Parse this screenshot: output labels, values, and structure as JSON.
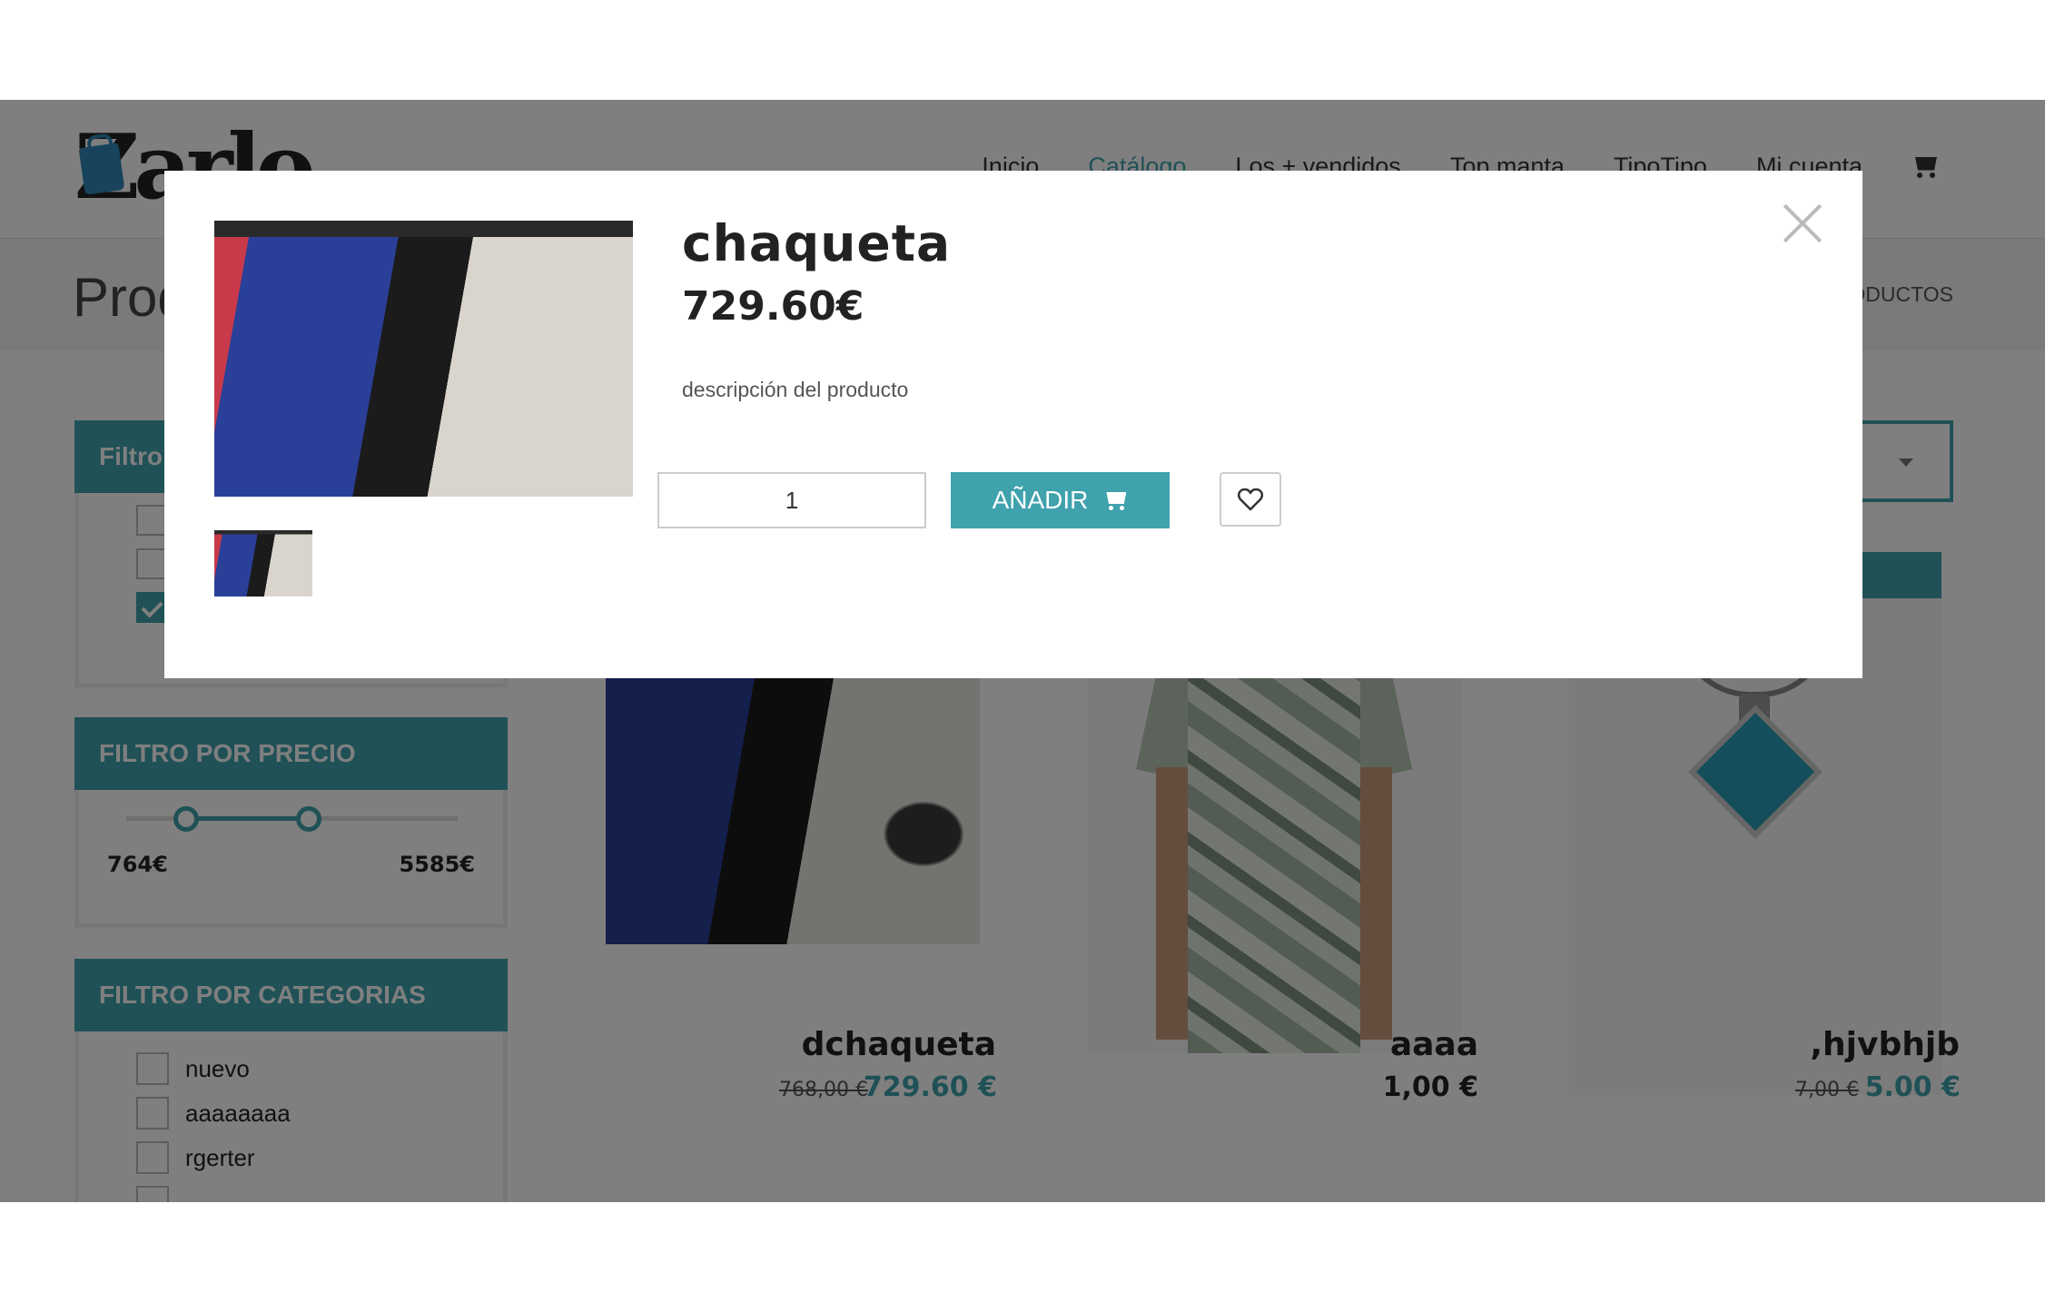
{
  "header": {
    "logo_text": "Zarlo",
    "nav": [
      {
        "label": "Inicio"
      },
      {
        "label": "Catálogo"
      },
      {
        "label": "Los + vendidos"
      },
      {
        "label": "Top manta"
      },
      {
        "label": "TipoTipo"
      },
      {
        "label": "Mi cuenta"
      }
    ],
    "cart_icon": "shopping-cart-icon"
  },
  "page": {
    "title": "Productos",
    "breadcrumb": "Productos"
  },
  "sidebar": {
    "filter1_title": "Filtro",
    "price_filter": {
      "title": "FILTRO POR PRECIO",
      "min_label": "764€",
      "max_label": "5585€",
      "range_start_fraction": 0.18,
      "range_end_fraction": 0.55
    },
    "category_filter": {
      "title": "FILTRO POR CATEGORIAS",
      "items": [
        "nuevo",
        "aaaaaaaa",
        "rgerter"
      ]
    }
  },
  "products": [
    {
      "name": "dchaqueta",
      "old_price": "768,00 €",
      "price": "729.60 €"
    },
    {
      "name": "aaaa",
      "price": "1,00 €"
    },
    {
      "name": ",hjvbhjb",
      "old_price": "7,00 €",
      "price": "5.00 €"
    }
  ],
  "modal": {
    "title": "chaqueta",
    "price": "729.60€",
    "description": "descripción del producto",
    "quantity": "1",
    "add_label": "AÑADIR",
    "fav_icon": "heart-icon",
    "close_icon": "close-icon"
  },
  "colors": {
    "accent": "#3fa2ad",
    "overlay": "rgba(0,0,0,0.5)"
  }
}
